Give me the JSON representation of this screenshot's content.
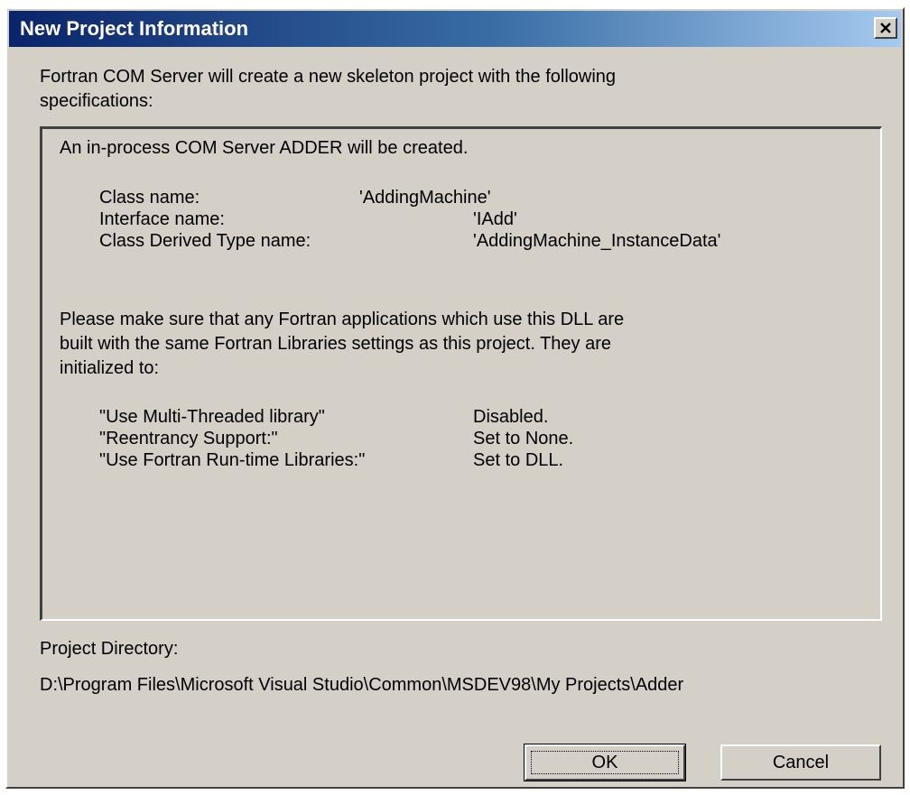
{
  "window": {
    "title": "New Project Information"
  },
  "intro": {
    "line1": "Fortran COM Server will create a new skeleton project with the following",
    "line2": "specifications:"
  },
  "spec": {
    "heading": "An in-process COM Server ADDER will be created.",
    "class_name_label": "Class name:",
    "class_name_value": "'AddingMachine'",
    "interface_name_label": "Interface name:",
    "interface_name_value": "'IAdd'",
    "derived_type_label": "Class Derived Type name:",
    "derived_type_value": "'AddingMachine_InstanceData'",
    "notice_line1": "Please make sure that any Fortran applications which use this DLL are",
    "notice_line2": "built with the same Fortran Libraries settings as this project.  They are",
    "notice_line3": "initialized to:",
    "settings": [
      {
        "name": "\"Use Multi-Threaded library\"",
        "value": "Disabled."
      },
      {
        "name": "\"Reentrancy Support:\"",
        "value": "Set to None."
      },
      {
        "name": "\"Use Fortran Run-time Libraries:\"",
        "value": "Set to DLL."
      }
    ]
  },
  "directory": {
    "label": "Project Directory:",
    "value": "D:\\Program Files\\Microsoft Visual Studio\\Common\\MSDEV98\\My Projects\\Adder"
  },
  "buttons": {
    "ok": "OK",
    "cancel": "Cancel"
  },
  "colors": {
    "title_gradient_start": "#0a246a",
    "title_gradient_end": "#a6caf0",
    "face": "#d4d0c8"
  },
  "icons": {
    "close": "close-icon"
  }
}
